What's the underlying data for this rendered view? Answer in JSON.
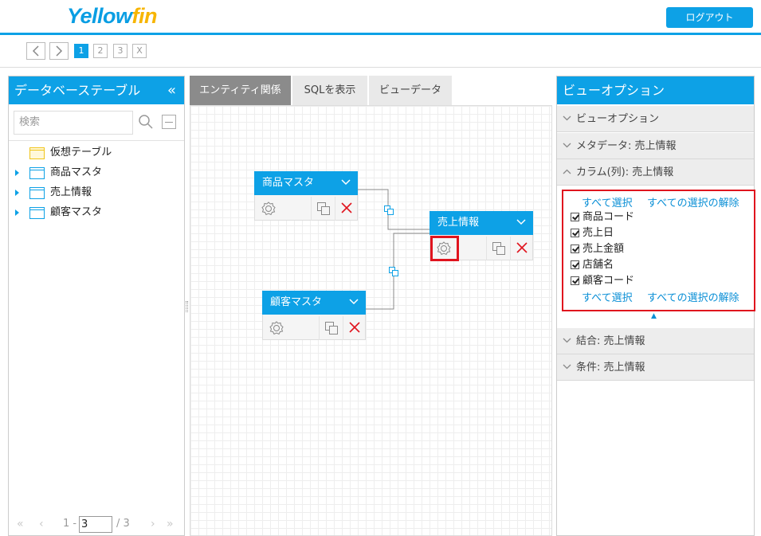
{
  "header": {
    "logo_part1": "Yellow",
    "logo_part2": "fin",
    "logout_label": "ログアウト"
  },
  "pager": {
    "pages": [
      "1",
      "2",
      "3"
    ],
    "close_label": "X",
    "active_page": "1"
  },
  "left_panel": {
    "title": "データベーステーブル",
    "collapse_glyph": "«",
    "search_placeholder": "検索",
    "tree": [
      {
        "label": "仮想テーブル",
        "expandable": false,
        "virtual": true
      },
      {
        "label": "商品マスタ",
        "expandable": true
      },
      {
        "label": "売上情報",
        "expandable": true
      },
      {
        "label": "顧客マスタ",
        "expandable": true
      }
    ],
    "footer": {
      "first": "«",
      "prev": "‹",
      "prefix": "1 -",
      "page_value": "3",
      "total": "/ 3",
      "next": "›",
      "last": "»"
    }
  },
  "center": {
    "tabs": [
      "エンティティ関係",
      "SQLを表示",
      "ビューデータ"
    ],
    "active_tab": "エンティティ関係",
    "entities": [
      {
        "name": "商品マスタ"
      },
      {
        "name": "売上情報"
      },
      {
        "name": "顧客マスタ"
      }
    ]
  },
  "right_panel": {
    "title": "ビューオプション",
    "sections_top": [
      "ビューオプション",
      "メタデータ: 売上情報",
      "カラム(列): 売上情報"
    ],
    "select_all": "すべて選択",
    "deselect_all": "すべての選択の解除",
    "columns": [
      "商品コード",
      "売上日",
      "売上金額",
      "店舗名",
      "顧客コード"
    ],
    "collapse_glyph": "▲",
    "sections_bottom": [
      "結合: 売上情報",
      "条件: 売上情報"
    ]
  },
  "colors": {
    "accent": "#0da1e6",
    "highlight": "#e0141e",
    "delete": "#e0141e"
  }
}
